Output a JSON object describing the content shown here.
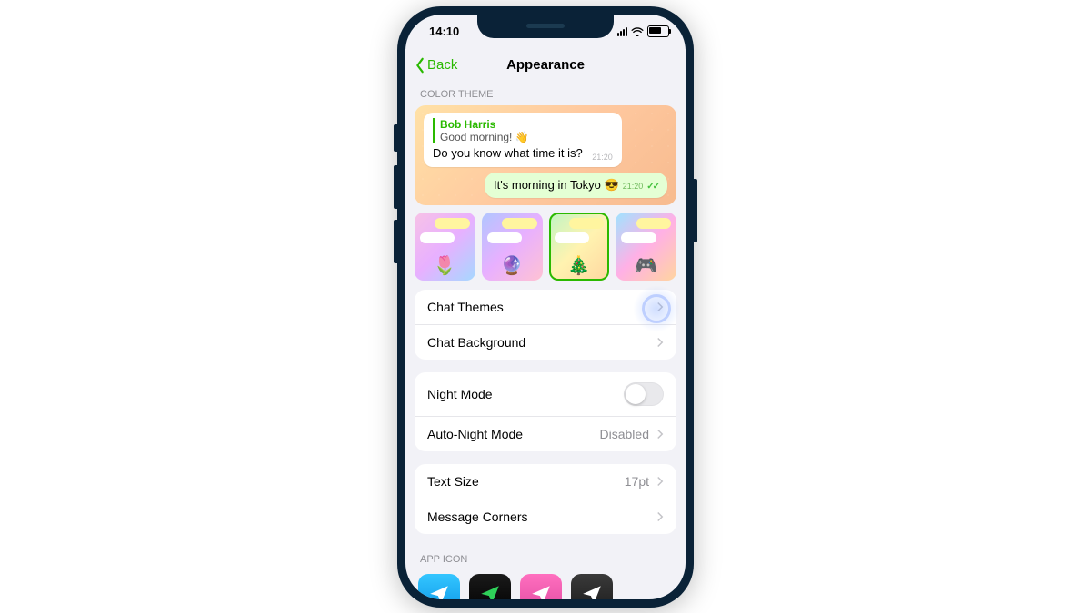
{
  "statusBar": {
    "time": "14:10"
  },
  "nav": {
    "back": "Back",
    "title": "Appearance"
  },
  "sections": {
    "colorTheme": "COLOR THEME",
    "appIcon": "APP ICON"
  },
  "preview": {
    "replyName": "Bob Harris",
    "replyText": "Good morning! 👋",
    "incomingText": "Do you know what time it is?",
    "incomingTime": "21:20",
    "outgoingText": "It's morning in Tokyo 😎",
    "outgoingTime": "21:20"
  },
  "themeSwatches": [
    {
      "emoji": "🌷",
      "selected": false
    },
    {
      "emoji": "🔮",
      "selected": false
    },
    {
      "emoji": "🎄",
      "selected": true
    },
    {
      "emoji": "🎮",
      "selected": false
    }
  ],
  "rows": {
    "chatThemes": "Chat Themes",
    "chatBackground": "Chat Background",
    "nightMode": "Night Mode",
    "autoNight": "Auto-Night Mode",
    "autoNightValue": "Disabled",
    "textSize": "Text Size",
    "textSizeValue": "17pt",
    "messageCorners": "Message Corners"
  }
}
